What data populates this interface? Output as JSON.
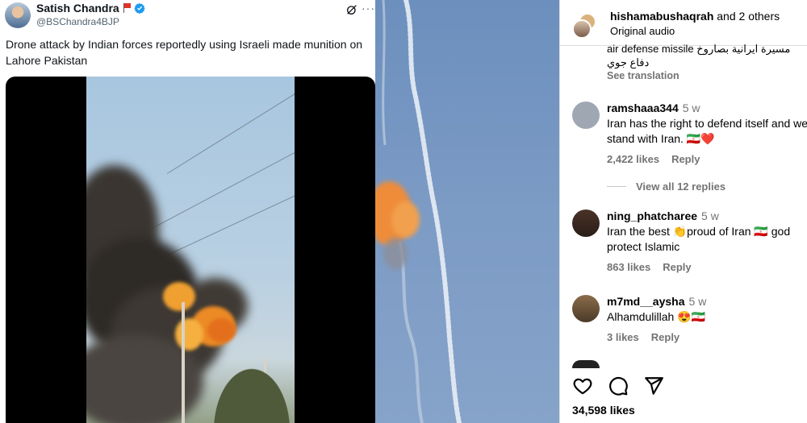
{
  "tweet": {
    "author_name": "Satish Chandra",
    "author_handle": "@BSChandra4BJP",
    "text": "Drone attack by Indian forces reportedly using Israeli made munition on Lahore Pakistan",
    "icons": [
      "avatar",
      "flag-icon",
      "verified-icon",
      "grok-icon",
      "more-icon"
    ]
  },
  "instagram": {
    "header": {
      "usernames": "hishamabushaqrah",
      "and_others": "and 2 others",
      "audio": "Original audio"
    },
    "cut_comment": {
      "line1": "air defense missile  مسيرة ايرانية بصاروخ",
      "line2": "دفاع جوي",
      "see_translation": "See translation"
    },
    "comments": [
      {
        "username": "ramshaaa344",
        "time": "5 w",
        "text": "Iran has the right to defend itself and we stand with Iran. 🇮🇷❤️",
        "likes": "2,422 likes",
        "reply": "Reply",
        "avatar_color": "#9fa7b3"
      },
      {
        "username": "ning_phatcharee",
        "time": "5 w",
        "text": "Iran the best 👏proud of Iran 🇮🇷 god protect Islamic",
        "likes": "863 likes",
        "reply": "Reply",
        "avatar_color": "#3b2a23"
      },
      {
        "username": "m7md__aysha",
        "time": "5 w",
        "text": "Alhamdulillah 😍🇮🇷",
        "likes": "3 likes",
        "reply": "Reply",
        "avatar_color": "#6a5238"
      }
    ],
    "view_replies": "View all 12 replies",
    "actions": [
      "heart-icon",
      "comment-icon",
      "share-icon"
    ],
    "total_likes": "34,598 likes"
  }
}
